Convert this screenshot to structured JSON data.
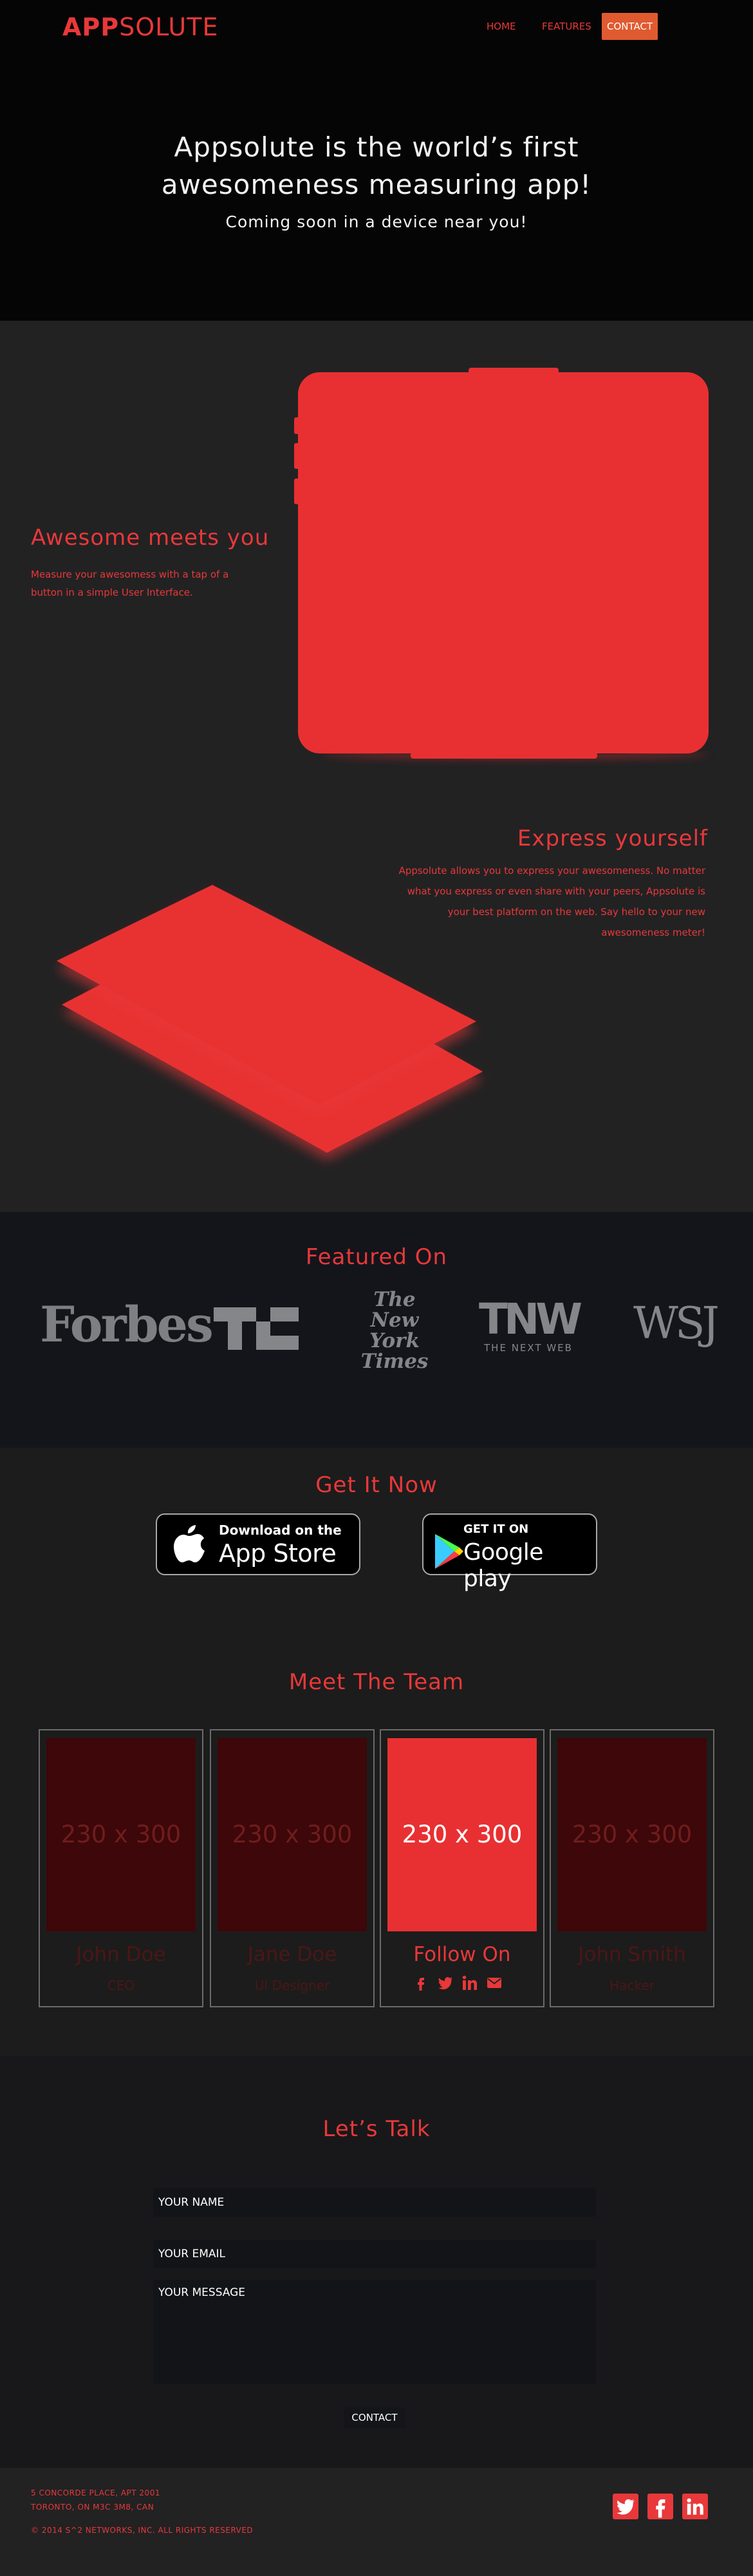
{
  "header": {
    "logo_bold": "APP",
    "logo_light": "SOLUTE",
    "nav": [
      "HOME",
      "FEATURES",
      "CONTACT"
    ]
  },
  "hero": {
    "title_line1": "Appsolute is the world’s first",
    "title_line2": "awesomeness measuring app!",
    "subtitle": "Coming soon in a device near you!"
  },
  "features": [
    {
      "title": "Awesome meets you",
      "text_lines": [
        "Measure your awesomess with a tap of a",
        "button in a simple User Interface."
      ]
    },
    {
      "title": "Express yourself",
      "text_lines": [
        "Appsolute allows you to express your awesomeness. No matter",
        "what you express or even share with your peers,  Appsolute is",
        "your best platform on the web. Say hello to your new",
        "awesomeness meter!"
      ]
    }
  ],
  "featured_on": {
    "title": "Featured  On",
    "outlets": [
      "Forbes",
      "TC",
      "The New York Times",
      "TNW",
      "THE NEXT WEB",
      "WSJ"
    ]
  },
  "get_it_now": {
    "title": "Get It Now",
    "app_store": {
      "small": "Download on the",
      "big": "App Store"
    },
    "google_play": {
      "small": "GET IT ON",
      "big": "Google play"
    }
  },
  "team": {
    "title": "Meet The Team",
    "members": [
      {
        "placeholder": "230 x 300",
        "name": "John Doe",
        "role": "CEO"
      },
      {
        "placeholder": "230 x 300",
        "name": "Jane Doe",
        "role": "UI Designer"
      },
      {
        "placeholder": "230 x 300",
        "name": "Follow On",
        "role": ""
      },
      {
        "placeholder": "230 x 300",
        "name": "John Smith",
        "role": "Hacker"
      }
    ],
    "social_icons": [
      "facebook-icon",
      "twitter-icon",
      "linkedin-icon",
      "email-icon"
    ]
  },
  "contact": {
    "title": "Let’s Talk",
    "name_placeholder": "YOUR NAME",
    "email_placeholder": "YOUR EMAIL",
    "message_placeholder": "YOUR MESSAGE",
    "button": "CONTACT"
  },
  "footer": {
    "address_line1": "5 CONCORDE PLACE, APT 2001",
    "address_line2": "TORONTO, ON M3C 3M8, CAN",
    "copyright": "© 2014 S^2 NETWORKS, INC. ALL RIGHTS RESERVED",
    "social_icons": [
      "twitter-icon",
      "facebook-icon",
      "linkedin-icon"
    ]
  },
  "colors": {
    "accent": "#e8383a",
    "nav_active": "#e05a30",
    "hero_bg": "#050505",
    "section_bg": "#222223",
    "featured_bg": "#13151b"
  }
}
